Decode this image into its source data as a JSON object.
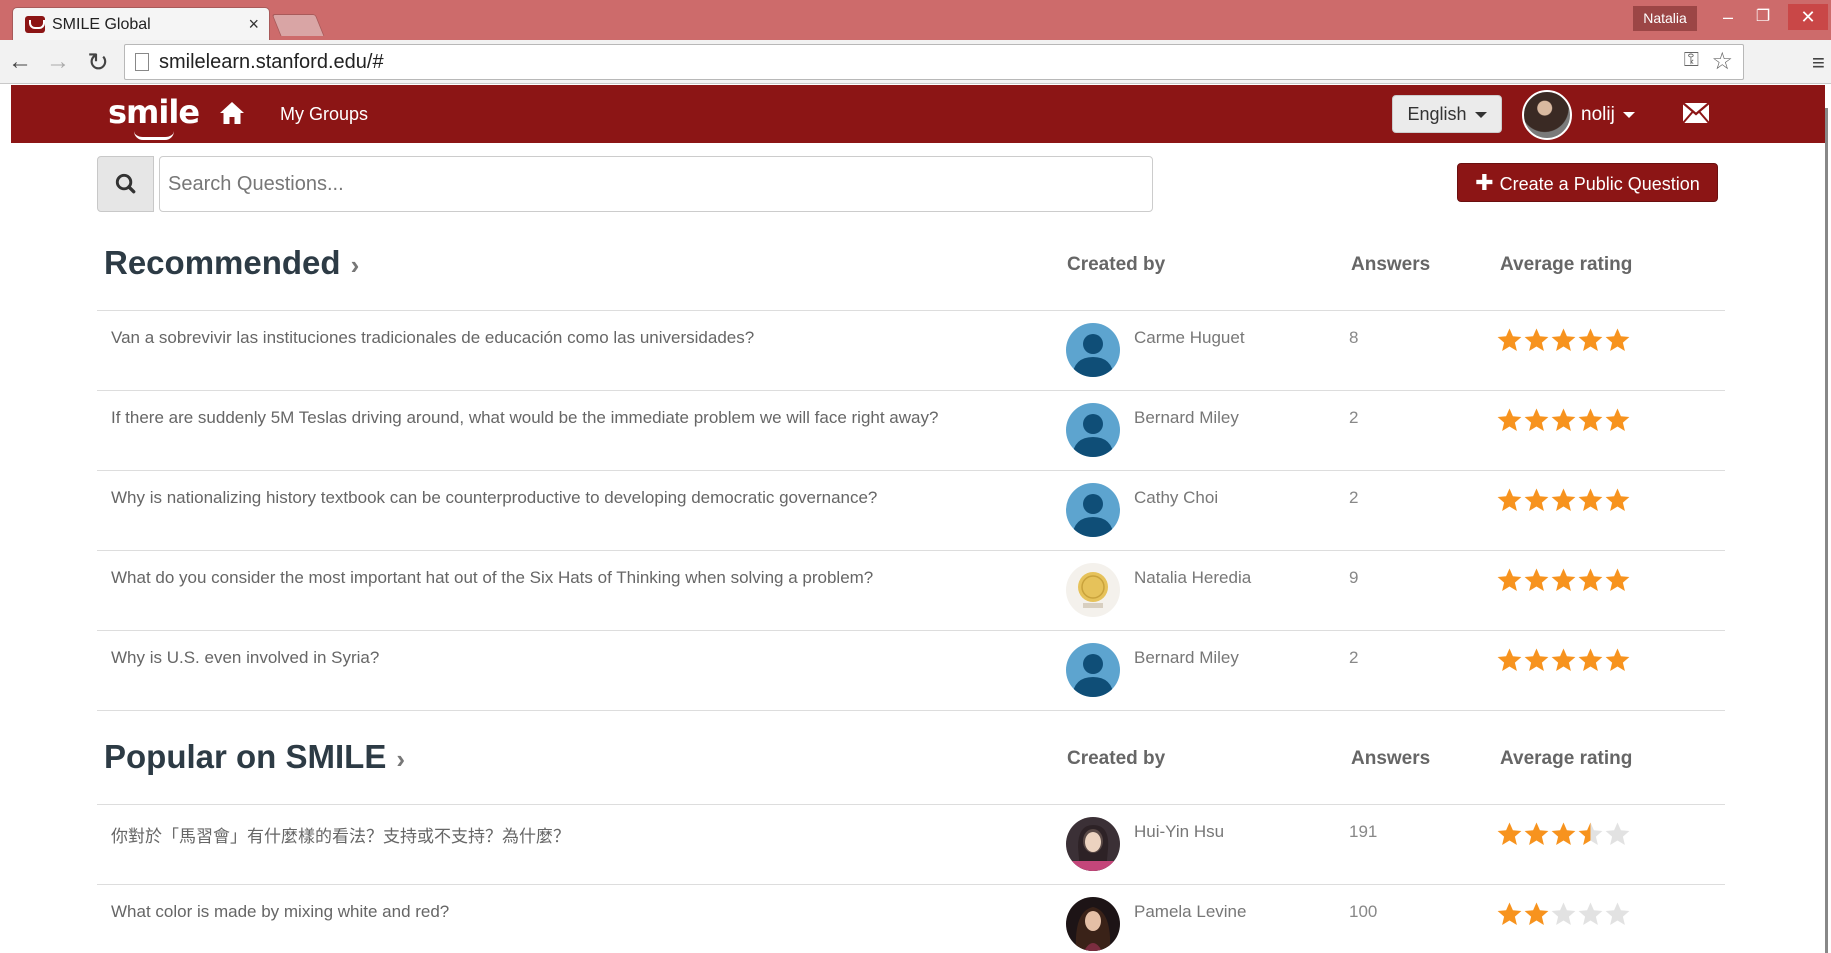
{
  "browser": {
    "tab_title": "SMILE Global",
    "tab_close": "×",
    "user_badge": "Natalia",
    "url": "smilelearn.stanford.edu/#",
    "window_controls": {
      "minimize": "–",
      "maximize": "❐",
      "close": "✕"
    }
  },
  "navbar": {
    "logo": "smile",
    "my_groups": "My Groups",
    "language": "English",
    "username": "nolij",
    "brand_color": "#8c1515"
  },
  "search": {
    "placeholder": "Search Questions...",
    "create_label": "Create a Public Question"
  },
  "columns": {
    "created_by": "Created by",
    "answers": "Answers",
    "rating": "Average rating"
  },
  "sections": {
    "recommended": {
      "title": "Recommended",
      "rows": [
        {
          "question": "Van a sobrevivir las instituciones tradicionales de educación como las universidades?",
          "author": "Carme Huguet",
          "answers": "8",
          "rating": 5,
          "avatar": "default"
        },
        {
          "question": "If there are suddenly 5M Teslas driving around, what would be the immediate problem we will face right away?",
          "author": "Bernard Miley",
          "answers": "2",
          "rating": 5,
          "avatar": "default"
        },
        {
          "question": "Why is nationalizing history textbook can be counterproductive to developing democratic governance?",
          "author": "Cathy Choi",
          "answers": "2",
          "rating": 5,
          "avatar": "default"
        },
        {
          "question": "What do you consider the most important hat out of the Six Hats of Thinking when solving a problem?",
          "author": "Natalia Heredia",
          "answers": "9",
          "rating": 5,
          "avatar": "seal"
        },
        {
          "question": "Why is U.S. even involved in Syria?",
          "author": "Bernard Miley",
          "answers": "2",
          "rating": 5,
          "avatar": "default"
        }
      ]
    },
    "popular": {
      "title": "Popular on SMILE",
      "rows": [
        {
          "question": "你對於「馬習會」有什麼樣的看法？支持或不支持？為什麼？",
          "author": "Hui-Yin Hsu",
          "answers": "191",
          "rating": 3.5,
          "avatar": "photo1"
        },
        {
          "question": "What color is made by mixing white and red?",
          "author": "Pamela Levine",
          "answers": "100",
          "rating": 2,
          "avatar": "photo2"
        }
      ]
    }
  },
  "colors": {
    "star_filled": "#f7931e",
    "star_empty": "#e2e2e2"
  }
}
